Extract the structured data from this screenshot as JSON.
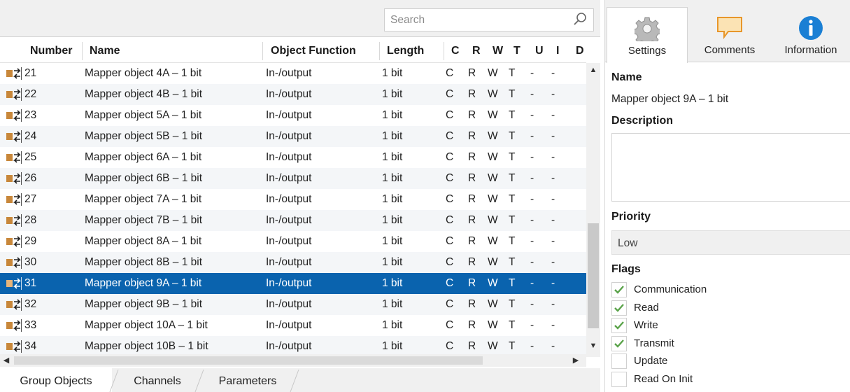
{
  "search": {
    "placeholder": "Search",
    "value": ""
  },
  "table": {
    "columns": [
      "Number",
      "Name",
      "Object Function",
      "Length",
      "C",
      "R",
      "W",
      "T",
      "U",
      "I",
      "D"
    ],
    "rows": [
      {
        "number": "21",
        "name": "Mapper object 4A – 1 bit",
        "function": "In-/output",
        "length": "1 bit",
        "c": "C",
        "r": "R",
        "w": "W",
        "t": "T",
        "u": "-",
        "i": "-"
      },
      {
        "number": "22",
        "name": "Mapper object 4B – 1 bit",
        "function": "In-/output",
        "length": "1 bit",
        "c": "C",
        "r": "R",
        "w": "W",
        "t": "T",
        "u": "-",
        "i": "-"
      },
      {
        "number": "23",
        "name": "Mapper object 5A – 1 bit",
        "function": "In-/output",
        "length": "1 bit",
        "c": "C",
        "r": "R",
        "w": "W",
        "t": "T",
        "u": "-",
        "i": "-"
      },
      {
        "number": "24",
        "name": "Mapper object 5B – 1 bit",
        "function": "In-/output",
        "length": "1 bit",
        "c": "C",
        "r": "R",
        "w": "W",
        "t": "T",
        "u": "-",
        "i": "-"
      },
      {
        "number": "25",
        "name": "Mapper object 6A – 1 bit",
        "function": "In-/output",
        "length": "1 bit",
        "c": "C",
        "r": "R",
        "w": "W",
        "t": "T",
        "u": "-",
        "i": "-"
      },
      {
        "number": "26",
        "name": "Mapper object 6B – 1 bit",
        "function": "In-/output",
        "length": "1 bit",
        "c": "C",
        "r": "R",
        "w": "W",
        "t": "T",
        "u": "-",
        "i": "-"
      },
      {
        "number": "27",
        "name": "Mapper object 7A – 1 bit",
        "function": "In-/output",
        "length": "1 bit",
        "c": "C",
        "r": "R",
        "w": "W",
        "t": "T",
        "u": "-",
        "i": "-"
      },
      {
        "number": "28",
        "name": "Mapper object 7B – 1 bit",
        "function": "In-/output",
        "length": "1 bit",
        "c": "C",
        "r": "R",
        "w": "W",
        "t": "T",
        "u": "-",
        "i": "-"
      },
      {
        "number": "29",
        "name": "Mapper object 8A – 1 bit",
        "function": "In-/output",
        "length": "1 bit",
        "c": "C",
        "r": "R",
        "w": "W",
        "t": "T",
        "u": "-",
        "i": "-"
      },
      {
        "number": "30",
        "name": "Mapper object 8B – 1 bit",
        "function": "In-/output",
        "length": "1 bit",
        "c": "C",
        "r": "R",
        "w": "W",
        "t": "T",
        "u": "-",
        "i": "-"
      },
      {
        "number": "31",
        "name": "Mapper object 9A – 1 bit",
        "function": "In-/output",
        "length": "1 bit",
        "c": "C",
        "r": "R",
        "w": "W",
        "t": "T",
        "u": "-",
        "i": "-"
      },
      {
        "number": "32",
        "name": "Mapper object 9B – 1 bit",
        "function": "In-/output",
        "length": "1 bit",
        "c": "C",
        "r": "R",
        "w": "W",
        "t": "T",
        "u": "-",
        "i": "-"
      },
      {
        "number": "33",
        "name": "Mapper object 10A – 1 bit",
        "function": "In-/output",
        "length": "1 bit",
        "c": "C",
        "r": "R",
        "w": "W",
        "t": "T",
        "u": "-",
        "i": "-"
      },
      {
        "number": "34",
        "name": "Mapper object 10B – 1 bit",
        "function": "In-/output",
        "length": "1 bit",
        "c": "C",
        "r": "R",
        "w": "W",
        "t": "T",
        "u": "-",
        "i": "-"
      }
    ],
    "selected_number": "31"
  },
  "bottom_tabs": [
    "Group Objects",
    "Channels",
    "Parameters"
  ],
  "right_tabs": [
    {
      "label": "Settings",
      "icon": "gear-icon",
      "active": true
    },
    {
      "label": "Comments",
      "icon": "comment-icon",
      "active": false
    },
    {
      "label": "Information",
      "icon": "info-icon",
      "active": false
    }
  ],
  "properties": {
    "name_label": "Name",
    "name_value": "Mapper object 9A – 1 bit",
    "description_label": "Description",
    "description_value": "",
    "priority_label": "Priority",
    "priority_value": "Low",
    "flags_label": "Flags",
    "flags": [
      {
        "label": "Communication",
        "checked": true
      },
      {
        "label": "Read",
        "checked": true
      },
      {
        "label": "Write",
        "checked": true
      },
      {
        "label": "Transmit",
        "checked": true
      },
      {
        "label": "Update",
        "checked": false
      },
      {
        "label": "Read On Init",
        "checked": false
      }
    ]
  },
  "colors": {
    "selection": "#0a63ae",
    "check": "#5aa34a",
    "object_icon": "#c8873a",
    "info_blue": "#1a7fd4",
    "comment_orange": "#f0a030"
  }
}
